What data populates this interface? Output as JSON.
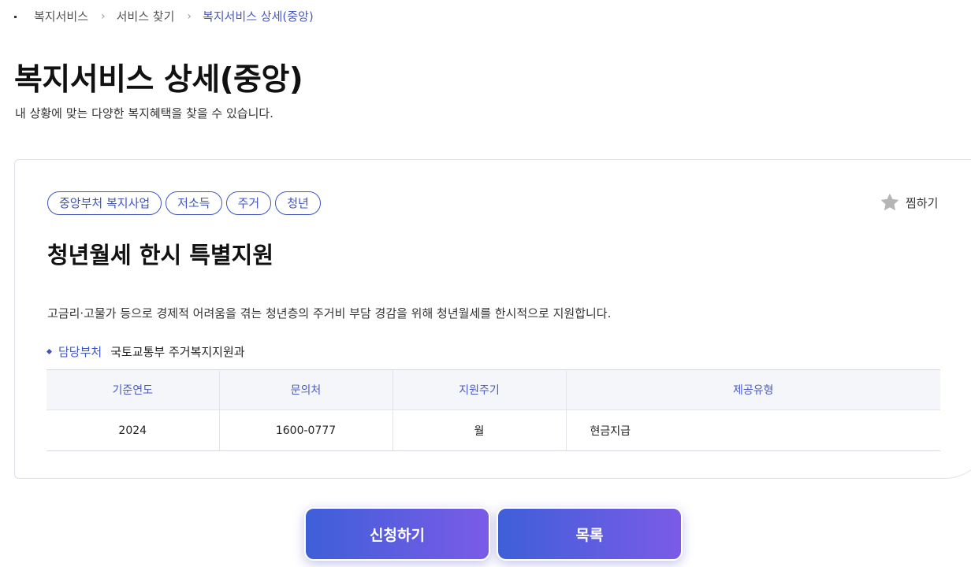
{
  "breadcrumb": {
    "items": [
      "복지서비스",
      "서비스 찾기",
      "복지서비스 상세(중앙)"
    ]
  },
  "page": {
    "title": "복지서비스 상세(중앙)",
    "subtitle": "내 상황에 맞는 다양한 복지혜택을 찾을 수 있습니다."
  },
  "service": {
    "tags": [
      "중앙부처 복지사업",
      "저소득",
      "주거",
      "청년"
    ],
    "favorite_label": "찜하기",
    "title": "청년월세 한시 특별지원",
    "description": "고금리·고물가 등으로 경제적 어려움을 겪는 청년층의 주거비 부담 경감을 위해 청년월세를 한시적으로 지원합니다.",
    "dept_label": "담당부처",
    "dept_value": "국토교통부 주거복지지원과",
    "table": {
      "headers": [
        "기준연도",
        "문의처",
        "지원주기",
        "제공유형"
      ],
      "row": [
        "2024",
        "1600-0777",
        "월",
        "현금지급"
      ]
    }
  },
  "actions": {
    "apply_label": "신청하기",
    "list_label": "목록"
  },
  "colors": {
    "accent": "#3f55c2",
    "button_gradient_start": "#3e5fd8",
    "button_gradient_end": "#7b5be8",
    "star": "#b5b5b5"
  }
}
